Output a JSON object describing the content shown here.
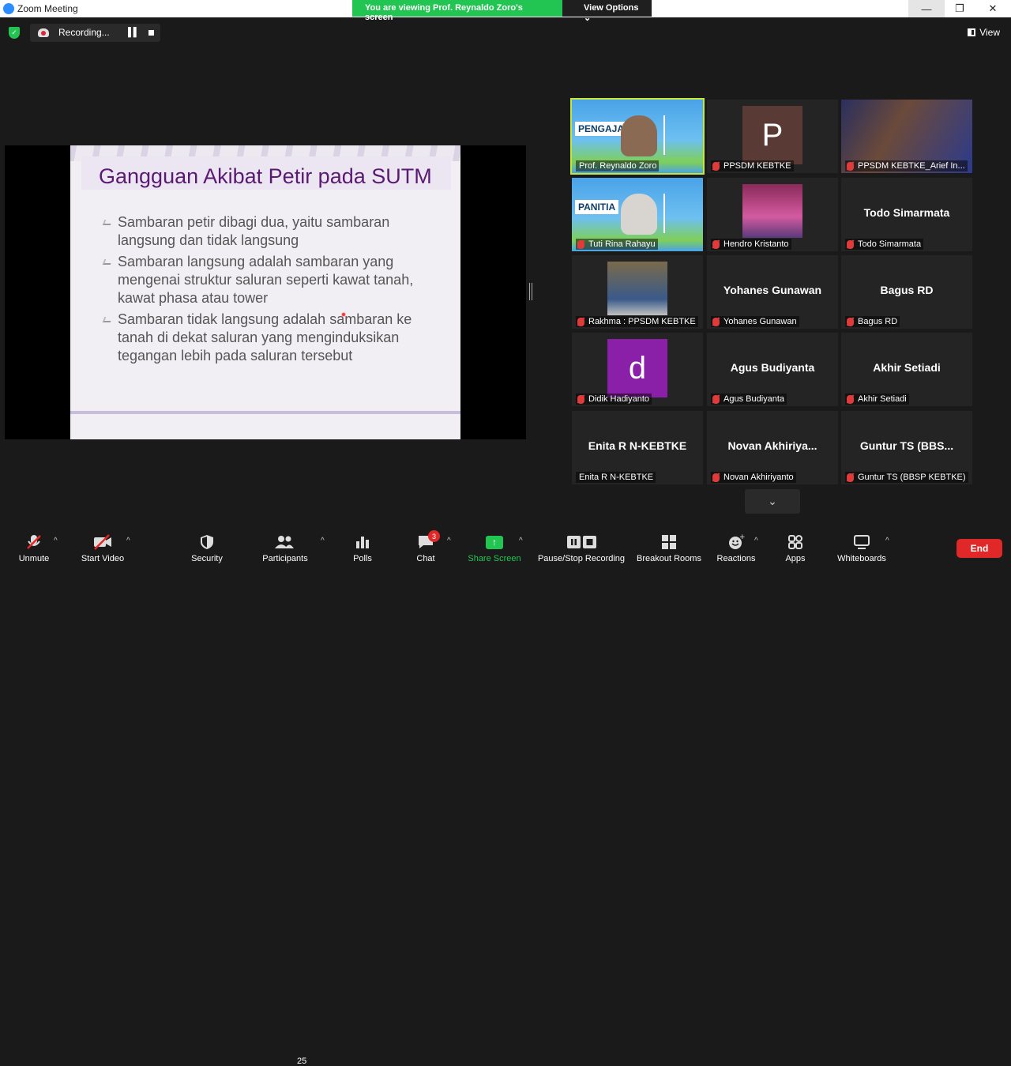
{
  "window": {
    "title": "Zoom Meeting"
  },
  "banner": {
    "viewing": "You are viewing Prof. Reynaldo Zoro's screen",
    "view_options": "View Options ⌄"
  },
  "topbar": {
    "recording_label": "Recording...",
    "view_label": "View"
  },
  "slide": {
    "title": "Gangguan Akibat Petir pada SUTM",
    "bullets": [
      "Sambaran petir dibagi dua, yaitu sambaran langsung dan tidak langsung",
      "Sambaran langsung adalah sambaran yang mengenai struktur saluran seperti kawat tanah, kawat phasa atau tower",
      "Sambaran tidak langsung adalah sambaran ke tanah di dekat saluran yang menginduksikan tegangan lebih pada saluran tersebut"
    ]
  },
  "gallery": [
    {
      "name": "Prof. Reynaldo Zoro",
      "muted": false,
      "active": true,
      "kind": "video",
      "poster_text": "PENGAJAR"
    },
    {
      "name": "PPSDM KEBTKE",
      "muted": true,
      "kind": "letter",
      "letter": "P",
      "color": "#5a3a34"
    },
    {
      "name": "PPSDM KEBTKE_Arief In...",
      "muted": true,
      "kind": "photo"
    },
    {
      "name": "Tuti Rina Rahayu",
      "muted": true,
      "kind": "video",
      "poster_text": "PANITIA"
    },
    {
      "name": "Hendro Kristanto",
      "muted": true,
      "kind": "photo-small"
    },
    {
      "name": "Todo Simarmata",
      "muted": true,
      "kind": "text",
      "display": "Todo Simarmata"
    },
    {
      "name": "Rakhma : PPSDM KEBTKE",
      "muted": true,
      "kind": "photo-person"
    },
    {
      "name": "Yohanes Gunawan",
      "muted": true,
      "kind": "text",
      "display": "Yohanes Gunawan"
    },
    {
      "name": "Bagus RD",
      "muted": true,
      "kind": "text",
      "display": "Bagus RD"
    },
    {
      "name": "Didik Hadiyanto",
      "muted": true,
      "kind": "letter",
      "letter": "d",
      "color": "#8a1fa8"
    },
    {
      "name": "Agus Budiyanta",
      "muted": true,
      "kind": "text",
      "display": "Agus Budiyanta"
    },
    {
      "name": "Akhir Setiadi",
      "muted": true,
      "kind": "text",
      "display": "Akhir Setiadi"
    },
    {
      "name": "Enita R N-KEBTKE",
      "muted": false,
      "kind": "text",
      "display": "Enita R N-KEBTKE"
    },
    {
      "name": "Novan Akhiriyanto",
      "muted": true,
      "kind": "text",
      "display": "Novan  Akhiriya..."
    },
    {
      "name": "Guntur TS (BBSP KEBTKE)",
      "muted": true,
      "kind": "text",
      "display": "Guntur TS (BBS..."
    }
  ],
  "toolbar": {
    "unmute": "Unmute",
    "start_video": "Start Video",
    "security": "Security",
    "participants": "Participants",
    "participants_count": "25",
    "polls": "Polls",
    "chat": "Chat",
    "chat_badge": "3",
    "share_screen": "Share Screen",
    "pause_stop_recording": "Pause/Stop Recording",
    "breakout_rooms": "Breakout Rooms",
    "reactions": "Reactions",
    "apps": "Apps",
    "whiteboards": "Whiteboards",
    "end": "End"
  },
  "colors": {
    "accent_green": "#23c552",
    "end_red": "#e02828",
    "active_border": "#c7e63a",
    "slide_title": "#5a1a72"
  }
}
